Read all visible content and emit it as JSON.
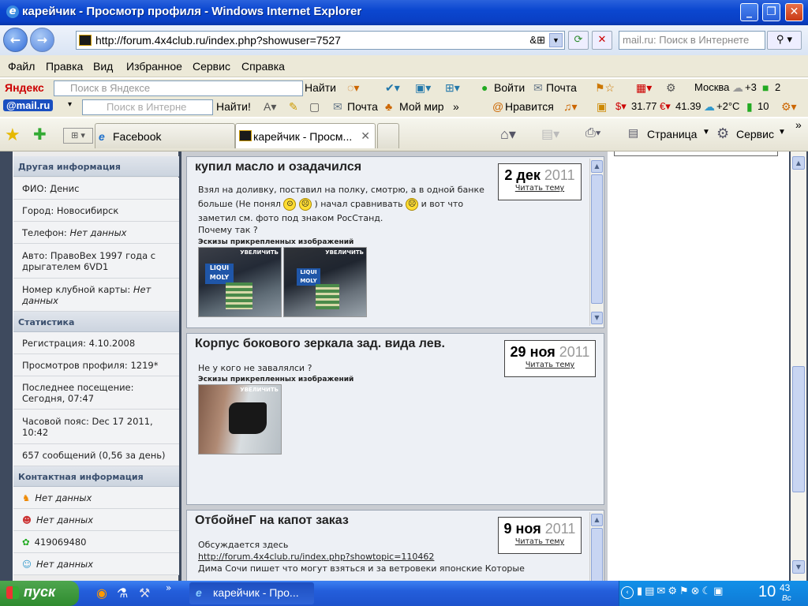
{
  "window": {
    "title": "карейчик - Просмотр профиля - Windows Internet Explorer"
  },
  "address": {
    "url": "http://forum.4x4club.ru/index.php?showuser=7527",
    "search_placeholder": "mail.ru: Поиск в Интернете"
  },
  "menu": [
    "Файл",
    "Правка",
    "Вид",
    "Избранное",
    "Сервис",
    "Справка"
  ],
  "yandex": {
    "logo": "Яндекс",
    "placeholder": "Поиск в Яндексе",
    "find": "Найти",
    "login": "Войти",
    "mail": "Почта",
    "city": "Москва",
    "temp": "+3",
    "count": "2"
  },
  "mailru": {
    "logo": "@mail.ru",
    "placeholder": "Поиск в Интерне",
    "find": "Найти!",
    "mail": "Почта",
    "myworld": "Мой мир",
    "like": "Нравится",
    "usd": "31.77",
    "eur": "41.39",
    "weather": "+2°C",
    "traffic": "10"
  },
  "tabs": [
    {
      "label": "Facebook"
    },
    {
      "label": "карейчик - Просм..."
    }
  ],
  "cmdbar": {
    "page": "Страница",
    "tools": "Сервис"
  },
  "sidebar": {
    "other_head": "Другая информация",
    "name": "ФИО: Денис",
    "city": "Город: Новосибирск",
    "phone_label": "Телефон: ",
    "phone_val": "Нет данных",
    "car": "Авто: ПравоВех 1997 года с дрыгателем 6VD1",
    "card_label": "Номер клубной карты: ",
    "card_val": "Нет данных",
    "stats_head": "Статистика",
    "reg": "Регистрация: 4.10.2008",
    "views": "Просмотров профиля: 1219*",
    "last_visit": "Последнее посещение: Сегодня, 07:47",
    "tz": "Часовой пояс: Dec 17 2011, 10:42",
    "msgs": "657 сообщений (0,56 за день)",
    "contact_head": "Контактная информация",
    "c1": "Нет данных",
    "c2": "Нет данных",
    "icq": "419069480",
    "c4": "Нет данных"
  },
  "posts": [
    {
      "title": "купил масло и озадачился",
      "day": "2 дек",
      "year": "2011",
      "read": "Читать тему",
      "l1": "Взял на доливку, поставил на полку, смотрю, а в одной банке",
      "l2a": "больше (Не понял",
      "l2b": ") начал сравнивать",
      "l2c": "и вот что",
      "l3": "заметил см. фото под знаком РосСтанд.",
      "l4": "Почему так ?",
      "att": "Эскизы прикрепленных изображений",
      "zoom": "УВЕЛИЧИТЬ"
    },
    {
      "title": "Корпус бокового зеркала зад. вида лев.",
      "day": "29 ноя",
      "year": "2011",
      "read": "Читать тему",
      "l1": "Не у кого не завалялси ?",
      "att": "Эскизы прикрепленных изображений",
      "zoom": "УВЕЛИЧИТЬ"
    },
    {
      "title": "ОтбойнеГ на капот заказ",
      "day": "9 ноя",
      "year": "2011",
      "read": "Читать тему",
      "l1": "Обсуждается здесь",
      "link": "http://forum.4x4club.ru/index.php?showtopic=110462",
      "l3": "Дима Сочи пишет что могут взяться и за ветровеки японские Которые"
    }
  ],
  "taskbar": {
    "start": "пуск",
    "task": "карейчик - Про...",
    "clock": "10",
    "clock_min": "43",
    "clock_sub": "Вс"
  }
}
